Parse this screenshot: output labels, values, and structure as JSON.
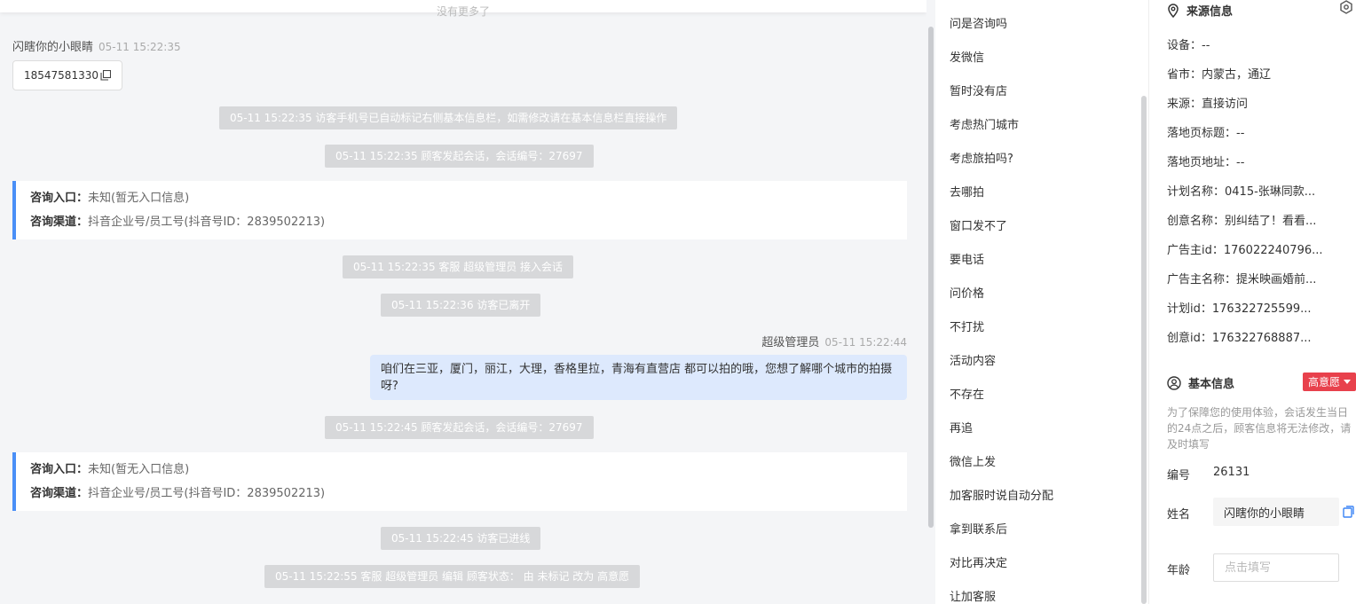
{
  "chat": {
    "no_more": "没有更多了",
    "visitor_name": "闪瞎你的小眼睛",
    "visitor_time": "05-11 15:22:35",
    "phone": "18547581330",
    "sys1": "05-11 15:22:35 访客手机号已自动标记右侧基本信息栏，如需修改请在基本信息栏直接操作",
    "sys2": "05-11 15:22:35 顾客发起会话，会话编号：27697",
    "card1": {
      "entry_label": "咨询入口：",
      "entry_value": "未知(暂无入口信息)",
      "channel_label": "咨询渠道：",
      "channel_value": "抖音企业号/员工号(抖音号ID：2839502213)"
    },
    "sys3": "05-11 15:22:35 客服 超级管理员 接入会话",
    "sys4": "05-11 15:22:36 访客已离开",
    "agent_name": "超级管理员",
    "agent_time": "05-11 15:22:44",
    "agent_message": "咱们在三亚，厦门，丽江，大理，香格里拉，青海有直营店 都可以拍的哦，您想了解哪个城市的拍摄呀?",
    "sys5": "05-11 15:22:45 顾客发起会话，会话编号：27697",
    "card2": {
      "entry_label": "咨询入口：",
      "entry_value": "未知(暂无入口信息)",
      "channel_label": "咨询渠道：",
      "channel_value": "抖音企业号/员工号(抖音号ID：2839502213)"
    },
    "sys6": "05-11 15:22:45 访客已进线",
    "sys7": "05-11 15:22:55 客服 超级管理员 编辑 顾客状态： 由 未标记 改为 高意愿"
  },
  "quick_replies": [
    "问是咨询吗",
    "发微信",
    "暂时没有店",
    "考虑热门城市",
    "考虑旅拍吗?",
    "去哪拍",
    "窗口发不了",
    "要电话",
    "问价格",
    "不打扰",
    "活动内容",
    "不存在",
    "再追",
    "微信上发",
    "加客服时说自动分配",
    "拿到联系后",
    "对比再决定",
    "让加客服"
  ],
  "source_info": {
    "title": "来源信息",
    "fields": [
      "设备：--",
      "省市：内蒙古，通辽",
      "来源：直接访问",
      "落地页标题：--",
      "落地页地址：--",
      "计划名称：0415-张琳同款...",
      "创意名称：别纠结了！看看...",
      "广告主id：176022240796...",
      "广告主名称：提米映画婚前...",
      "计划id：176322725599...",
      "创意id：176322768887..."
    ]
  },
  "basic_info": {
    "title": "基本信息",
    "intent_badge": "高意愿",
    "notice": "为了保障您的使用体验，会话发生当日的24点之后，顾客信息将无法修改，请及时填写",
    "id_label": "编号",
    "id_value": "26131",
    "name_label": "姓名",
    "name_value": "闪瞎你的小眼睛",
    "age_label": "年龄",
    "age_placeholder": "点击填写"
  },
  "colors": {
    "accent": "#4a8ff7",
    "agent_bubble": "#dde9fd",
    "system_bg": "#d7d8da",
    "badge": "#e8414c"
  }
}
